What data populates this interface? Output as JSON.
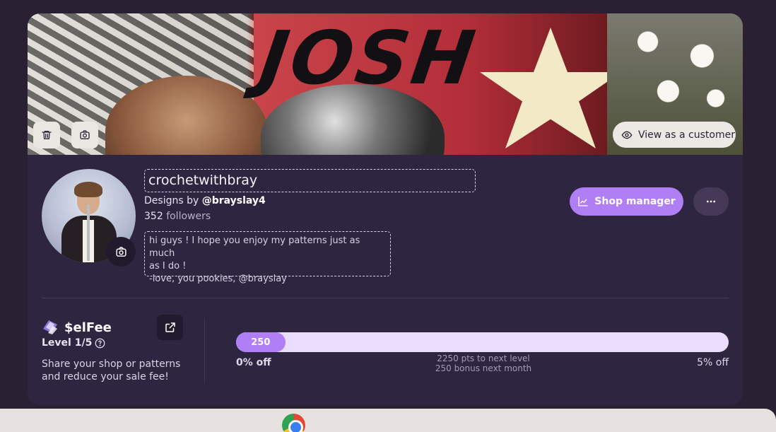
{
  "banner": {
    "collage_text": "JOSH",
    "view_as_customer_label": "View as a customer"
  },
  "shop": {
    "name": "crochetwithbray",
    "designs_by_prefix": "Designs by",
    "designer_handle": "@brayslay4",
    "followers_count": "352",
    "followers_label": "followers",
    "bio_lines": [
      "hi guys ! I hope you enjoy my patterns just as much",
      "as I do !",
      "-love, you pookies, @brayslay"
    ]
  },
  "actions": {
    "shop_manager_label": "Shop manager",
    "more_label": "···"
  },
  "selfee": {
    "title": "$elFee",
    "level_label": "Level 1/5",
    "description": "Share your shop or patterns and reduce your sale fee!",
    "progress_value": "250",
    "progress_fraction": 0.1,
    "left_label": "0% off",
    "right_label": "5% off",
    "pts_to_next": "2250 pts to next level",
    "bonus_next_month": "250 bonus next month"
  },
  "colors": {
    "accent": "#b07ef5",
    "card_bg": "#2e2641",
    "page_bg": "#2a2033",
    "progress_track": "#e9dcfd"
  },
  "icons": [
    "trash-icon",
    "camera-icon",
    "eye-icon",
    "chart-icon",
    "more-dots-icon",
    "external-link-icon",
    "help-circle-icon",
    "selfee-badge-icon",
    "chrome-icon"
  ]
}
